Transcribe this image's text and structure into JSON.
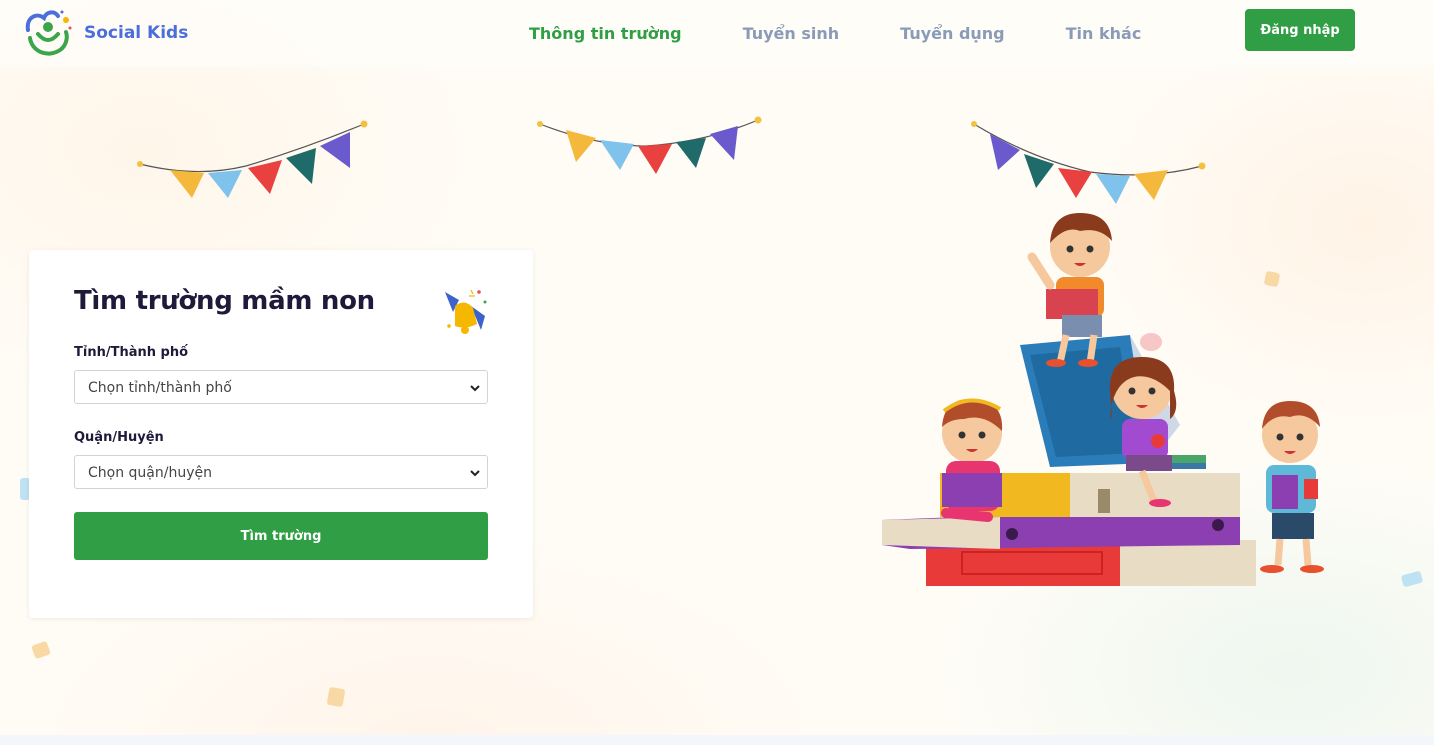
{
  "brand": {
    "name": "Social Kids"
  },
  "nav": {
    "items": [
      {
        "label": "Thông tin trường",
        "active": true
      },
      {
        "label": "Tuyển sinh",
        "active": false
      },
      {
        "label": "Tuyển dụng",
        "active": false
      },
      {
        "label": "Tin khác",
        "active": false
      }
    ],
    "login_label": "Đăng nhập"
  },
  "search_card": {
    "title": "Tìm trường mầm non",
    "province_label": "Tỉnh/Thành phố",
    "province_value": "Chọn tỉnh/thành phố",
    "district_label": "Quận/Huyện",
    "district_value": "Chọn quận/huyện",
    "submit_label": "Tìm trường"
  },
  "colors": {
    "primary_green": "#2f9e44",
    "brand_blue": "#4a6fdc",
    "nav_inactive": "#8a9bb8"
  },
  "icons": [
    "logo-icon",
    "bunting-decoration",
    "bell-icon",
    "chevron-down-icon",
    "children-reading-illustration"
  ]
}
